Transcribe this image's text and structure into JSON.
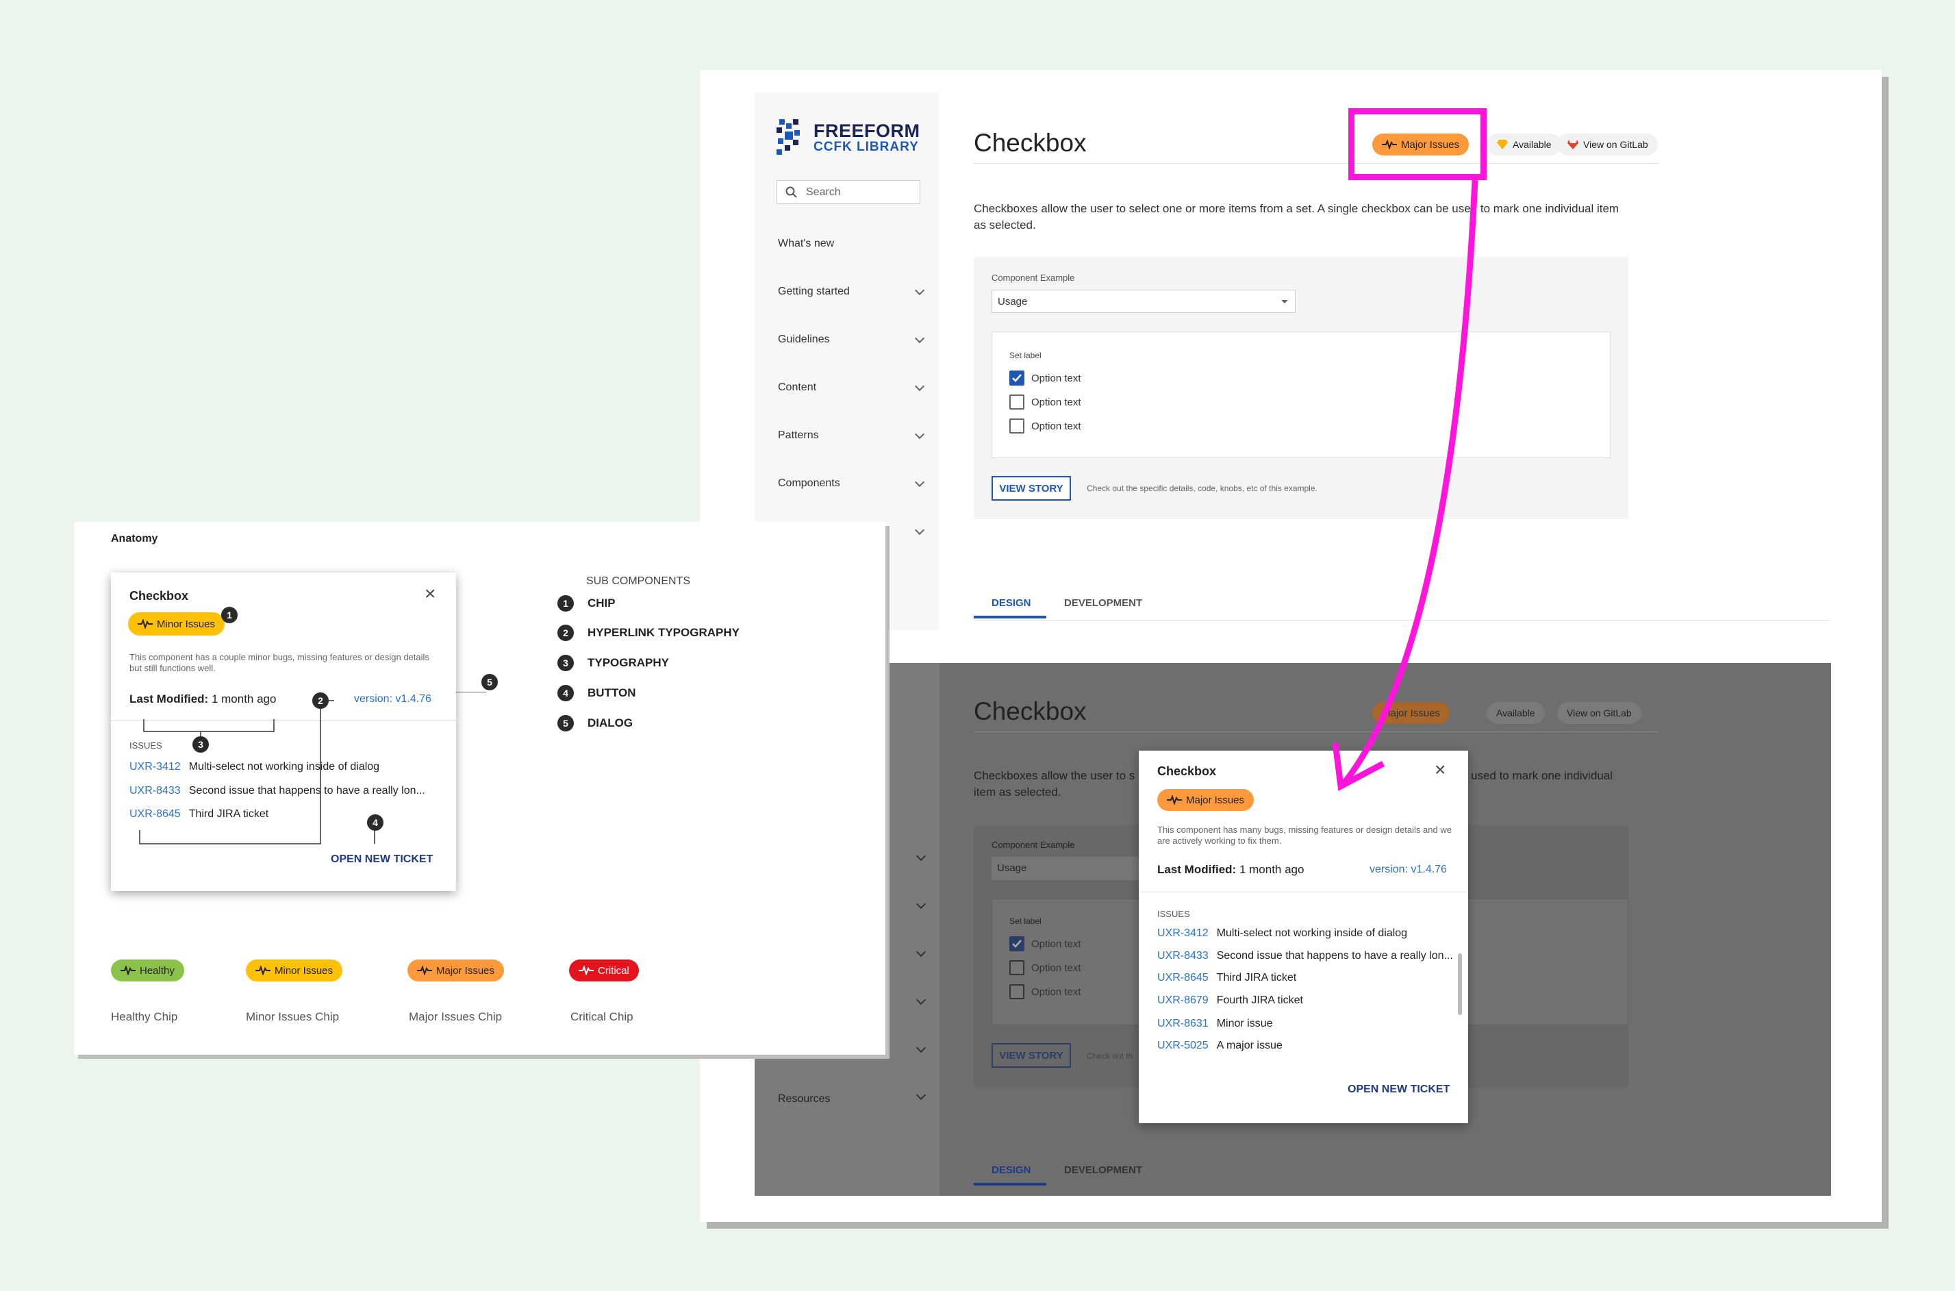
{
  "library": {
    "brand_line1": "FREEFORM",
    "brand_line2": "CCFK LIBRARY",
    "search_placeholder": "Search",
    "nav": [
      "What's new",
      "Getting started",
      "Guidelines",
      "Content",
      "Patterns",
      "Components",
      "Resources"
    ]
  },
  "page": {
    "title": "Checkbox",
    "chips": {
      "major": "Major Issues",
      "available": "Available",
      "gitlab": "View on GitLab"
    },
    "description": "Checkboxes allow the user to select one or more items from a set. A single checkbox can be used to mark one individual item as selected.",
    "description_dark_left": "Checkboxes allow the user to s",
    "description_dark_right": "used to mark one individual",
    "item_selected": "item as selected.",
    "example_label": "Component Example",
    "example_value": "Usage",
    "set_label": "Set label",
    "options": [
      {
        "label": "Option text",
        "checked": true
      },
      {
        "label": "Option text",
        "checked": false
      },
      {
        "label": "Option text",
        "checked": false
      }
    ],
    "view_story": "VIEW STORY",
    "view_story_note": "Check out the specific details, code, knobs, etc of this example.",
    "view_story_note_cut": "Check out th",
    "tabs": [
      "DESIGN",
      "DEVELOPMENT"
    ]
  },
  "dialog_major": {
    "title": "Checkbox",
    "chip": "Major Issues",
    "description": "This component has many bugs, missing features or design details and we are actively working to fix them.",
    "last_modified_label": "Last Modified:",
    "last_modified_value": "1 month ago",
    "version": "version: v1.4.76",
    "issues_heading": "ISSUES",
    "issues": [
      {
        "key": "UXR-3412",
        "text": "Multi-select not working inside of dialog"
      },
      {
        "key": "UXR-8433",
        "text": "Second issue that happens to have a really lon..."
      },
      {
        "key": "UXR-8645",
        "text": "Third JIRA ticket"
      },
      {
        "key": "UXR-8679",
        "text": "Fourth JIRA ticket"
      },
      {
        "key": "UXR-8631",
        "text": "Minor issue"
      },
      {
        "key": "UXR-5025",
        "text": "A major issue"
      }
    ],
    "open_ticket": "OPEN NEW TICKET"
  },
  "anatomy": {
    "heading": "Anatomy",
    "dialog": {
      "title": "Checkbox",
      "chip": "Minor Issues",
      "description": "This component has a couple minor bugs, missing features or design details but still functions well.",
      "last_modified_label": "Last Modified:",
      "last_modified_value": "1 month ago",
      "version": "version: v1.4.76",
      "issues_heading": "ISSUES",
      "issues": [
        {
          "key": "UXR-3412",
          "text": "Multi-select not working inside of dialog"
        },
        {
          "key": "UXR-8433",
          "text": "Second issue that happens to have a really lon..."
        },
        {
          "key": "UXR-8645",
          "text": "Third JIRA ticket"
        }
      ],
      "open_ticket": "OPEN NEW TICKET"
    },
    "sub_heading": "SUB COMPONENTS",
    "sub_components": [
      {
        "n": "1",
        "label": "CHIP"
      },
      {
        "n": "2",
        "label": "HYPERLINK TYPOGRAPHY"
      },
      {
        "n": "3",
        "label": "TYPOGRAPHY"
      },
      {
        "n": "4",
        "label": "BUTTON"
      },
      {
        "n": "5",
        "label": "DIALOG"
      }
    ],
    "markers": [
      "1",
      "2",
      "3",
      "4",
      "5"
    ],
    "chips": [
      {
        "chip": "Healthy",
        "label": "Healthy Chip",
        "color": "#8bc34a"
      },
      {
        "chip": "Minor Issues",
        "label": "Minor Issues Chip",
        "color": "#ffc107"
      },
      {
        "chip": "Major Issues",
        "label": "Major Issues Chip",
        "color": "#ff9a3c"
      },
      {
        "chip": "Critical",
        "label": "Critical Chip",
        "color": "#e3141e"
      }
    ]
  },
  "colors": {
    "highlight": "#ff14dc",
    "link": "#2a72c9",
    "primary": "#1e56b3"
  }
}
